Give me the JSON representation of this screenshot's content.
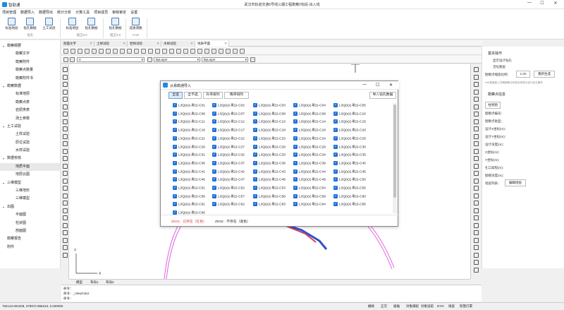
{
  "window": {
    "app_name": "智勘通",
    "title": "武汉市轨道交通6号线三期工程勘察2标段-出入线",
    "controls": [
      "—",
      "☐",
      "✕"
    ]
  },
  "menubar": [
    "项目管理",
    "数据导入",
    "数据导出",
    "统计分析",
    "计算工具",
    "项目成员",
    "审核审定",
    "设置"
  ],
  "ribbon": {
    "groups": [
      {
        "label": "钻孔",
        "buttons": [
          "标准地层",
          "钻孔数据",
          "土工试验"
        ]
      },
      {
        "label": "理正9.5",
        "buttons": [
          "标准地层",
          "钻孔数据"
        ]
      },
      {
        "label": "理正6.5",
        "buttons": [
          "钻孔数据"
        ]
      },
      {
        "label": "CAD",
        "buttons": [
          "选速测图"
        ]
      }
    ]
  },
  "sidebar": {
    "sections": [
      {
        "label": "勘察纲要",
        "items": [
          "勘察文字",
          "勘察附件",
          "勘察点数量",
          "勘察附件书"
        ]
      },
      {
        "label": "勘察数据",
        "items": [
          "标准地层",
          "勘察点表",
          "岩层类表",
          "测土参数"
        ]
      },
      {
        "label": "土工试验",
        "items": [
          "土样试验",
          "原位试验",
          "水样试验"
        ]
      },
      {
        "label": "数据校核",
        "items": [
          "地质平面",
          "地层云图"
        ]
      },
      {
        "label": "三维模型",
        "items": [
          "三维地形",
          "三维模型"
        ]
      },
      {
        "label": "出图",
        "items": [
          "平面图",
          "柱状图",
          "剖面图"
        ]
      },
      {
        "label": "勘察报告",
        "items": []
      },
      {
        "label": "附件",
        "items": []
      }
    ],
    "selected": "地质平面"
  },
  "doc_tabs": [
    "剖面文字",
    "土样试验",
    "岩样试验",
    "水样试验",
    "地质平面"
  ],
  "active_doc_tab": "地质平面",
  "cad": {
    "layer_value": "0",
    "linetype_value": "ByLayer",
    "lineweight_value": "ByLayer",
    "layout_tabs": [
      "模型",
      "布局1",
      "布局2"
    ],
    "command_lines": [
      "命令：",
      "命令：_ViewColor",
      "命令："
    ],
    "coordinates": "784143.004208, 378972.986163, 0.000000",
    "status_items": [
      "栅格",
      "正交",
      "极轴",
      "对象捕捉",
      "对象追踪",
      "DYN",
      "线宽",
      "智慧灯罩"
    ]
  },
  "props": {
    "basic_title": "基本操作",
    "show_design": "显示设计钻孔",
    "tidy": "活化图层",
    "scale_label": "勘察点缩放比例：",
    "scale_value": "1.00",
    "regen_button": "重新生成",
    "tip": "Nav按重新上归确勘察点标签名称显示设计钻孔编号",
    "info_title": "勘察点信息",
    "col_button": "柱状图",
    "fields": [
      "勘察点编号：",
      "勘察点类型：",
      "设计X坐标(m)：",
      "设计Y坐标(m)：",
      "设计深度(m)：",
      "X坐标(m)：",
      "Y坐标(m)：",
      "孔口高程(m)：",
      "勘察深度(m)：",
      "地层列表："
    ],
    "edit_strata": "编辑地层"
  },
  "dialog": {
    "title": "从易勘通导入",
    "buttons": [
      "全选",
      "全不选",
      "升序排列",
      "降序排列"
    ],
    "selected_button": "全选",
    "import_button": "导入钻孔数据",
    "items": [
      "L3Q(s)1-Ⅲ22-C01",
      "L3Q(s)1-Ⅲ22-C02",
      "L3Q(s)1-Ⅲ22-C03",
      "L3Q(s)1-Ⅲ22-C04",
      "L3Q(s)1-Ⅲ22-C05",
      "L3Q(s)1-Ⅲ22-C06",
      "L3Q(s)1-Ⅲ22-C07",
      "L3Q(s)1-Ⅲ22-C08",
      "L3Q(s)1-Ⅲ22-C09",
      "L3Q(s)1-Ⅲ22-C10",
      "L3Q(s)1-Ⅲ22-C11",
      "L3Q(s)1-Ⅲ22-C12",
      "L3Q(s)1-Ⅲ22-C13",
      "L3Q(s)1-Ⅲ22-C14",
      "L3Q(s)1-Ⅲ22-C15",
      "L3Q(s)1-Ⅲ22-C16",
      "L3Q(s)1-Ⅲ22-C17",
      "L3Q(s)1-Ⅲ22-C18",
      "L3Q(s)1-Ⅲ22-C19",
      "L3Q(s)1-Ⅲ22-C20",
      "L3Q(s)1-Ⅲ22-C21",
      "L3Q(s)1-Ⅲ22-C22",
      "L3Q(s)1-Ⅲ22-C23",
      "L3Q(s)1-Ⅲ22-C24",
      "L3Q(s)1-Ⅲ22-C25",
      "L3Q(s)1-Ⅲ22-C26",
      "L3Q(s)1-Ⅲ22-C27",
      "L3Q(s)1-Ⅲ22-C28",
      "L3Q(s)1-Ⅲ22-C29",
      "L3Q(s)1-Ⅲ22-C30",
      "L3Q(s)1-Ⅲ22-C31",
      "L3Q(s)1-Ⅲ22-C32",
      "L3Q(s)1-Ⅲ22-C33",
      "L3Q(s)1-Ⅲ22-C34",
      "L3Q(s)1-Ⅲ22-C35",
      "L3Q(s)1-Ⅲ22-C36",
      "L3Q(s)1-Ⅲ22-C37",
      "L3Q(s)1-Ⅲ22-C38",
      "L3Q(s)1-Ⅲ22-C39",
      "L3Q(s)1-Ⅲ22-C40",
      "L3Q(s)1-Ⅲ22-C41",
      "L3Q(s)1-Ⅲ22-C42",
      "L3Q(s)1-Ⅲ22-C43",
      "L3Q(s)1-Ⅲ22-C44",
      "L3Q(s)1-Ⅲ22-C45",
      "L3Q(s)1-Ⅲ22-C46",
      "L3Q(s)1-Ⅲ22-C47",
      "L3Q(s)1-Ⅲ22-C48",
      "L3Q(s)1-Ⅲ22-C49",
      "L3Q(s)1-Ⅲ22-C50",
      "L3Q(s)1-Ⅲ22-C51",
      "L3Q(s)1-Ⅲ22-C52",
      "L3Q(s)1-Ⅲ22-C53",
      "L3Q(s)1-Ⅲ22-C54",
      "L3Q(s)1-Ⅲ22-C55",
      "L3Q(s)1-Ⅲ22-C56",
      "L3Q(s)1-Ⅲ22-C57",
      "L3Q(s)1-Ⅲ22-C58",
      "L3Q(s)1-Ⅲ22-C59",
      "L3Q(s)1-Ⅲ22-C60",
      "L3Q(s)1-Ⅲ22-C61",
      "L3Q(s)1-Ⅲ22-C62",
      "L3Q(s)1-Ⅲ22-C63",
      "L3Q(s)1-Ⅲ22-C64",
      "L3Q(s)1-Ⅲ22-C65",
      "L3Q(s)1-Ⅲ22-C66"
    ],
    "legend_exists": "ZK01：已存在（红色）",
    "legend_missing": "ZK02：不存在（黑色）",
    "exists_color": "#e03030"
  }
}
